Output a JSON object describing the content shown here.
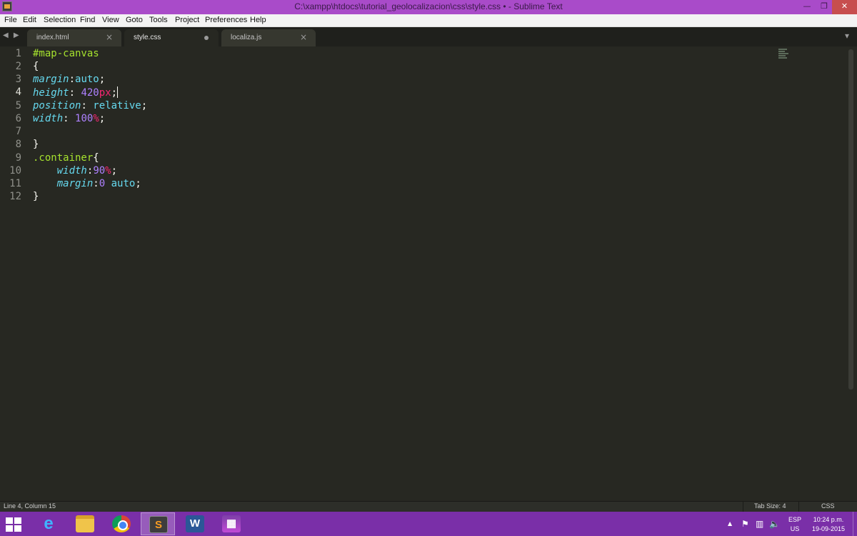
{
  "window": {
    "title": "C:\\xampp\\htdocs\\tutorial_geolocalizacion\\css\\style.css • - Sublime Text",
    "icons": {
      "app": "sublime-text-icon",
      "minimize": "minimize-icon",
      "maximize": "restore-icon",
      "close": "close-icon"
    },
    "minimize_glyph": "—",
    "maximize_glyph": "❐",
    "close_glyph": "✕"
  },
  "menu": [
    "File",
    "Edit",
    "Selection",
    "Find",
    "View",
    "Goto",
    "Tools",
    "Project",
    "Preferences",
    "Help"
  ],
  "tabs": [
    {
      "label": "index.html",
      "active": false,
      "dirty": false,
      "close_glyph": "×"
    },
    {
      "label": "style.css",
      "active": true,
      "dirty": true
    },
    {
      "label": "localiza.js",
      "active": false,
      "dirty": false,
      "close_glyph": "×"
    }
  ],
  "tabbar": {
    "nav_arrows": "◀ ▶",
    "overflow_glyph": "▾"
  },
  "editor": {
    "current_line": 4,
    "line_numbers": [
      "1",
      "2",
      "3",
      "4",
      "5",
      "6",
      "7",
      "8",
      "9",
      "10",
      "11",
      "12"
    ],
    "code": {
      "l1_selector": "#map-canvas",
      "l2_brace": "{",
      "l3_prop": "margin",
      "l3_colon": ":",
      "l3_val": "auto",
      "l3_semi": ";",
      "l4_prop": "height",
      "l4_colon": ": ",
      "l4_num": "420",
      "l4_unit": "px",
      "l4_semi": ";",
      "l5_prop": "position",
      "l5_colon": ": ",
      "l5_val": "relative",
      "l5_semi": ";",
      "l6_prop": "width",
      "l6_colon": ": ",
      "l6_num": "100",
      "l6_unit": "%",
      "l6_semi": ";",
      "l8_brace": "}",
      "l9_selector": ".container",
      "l9_brace": "{",
      "l10_indent": "    ",
      "l10_prop": "width",
      "l10_colon": ":",
      "l10_num": "90",
      "l10_unit": "%",
      "l10_semi": ";",
      "l11_indent": "    ",
      "l11_prop": "margin",
      "l11_colon": ":",
      "l11_num": "0",
      "l11_val": " auto",
      "l11_semi": ";",
      "l12_brace": "}"
    },
    "colors": {
      "background": "#272822",
      "selector": "#a6e22e",
      "property": "#66d9ef",
      "number": "#ae81ff",
      "unit": "#f92672",
      "text": "#f8f8f2"
    }
  },
  "status": {
    "position": "Line 4, Column 15",
    "tab_size": "Tab Size: 4",
    "syntax": "CSS"
  },
  "taskbar": {
    "apps": [
      {
        "name": "internet-explorer-icon",
        "glyph": "e",
        "active": false
      },
      {
        "name": "file-explorer-icon",
        "glyph": "",
        "active": false
      },
      {
        "name": "chrome-icon",
        "glyph": "",
        "active": false
      },
      {
        "name": "sublime-text-taskbar-icon",
        "glyph": "S",
        "active": true
      },
      {
        "name": "word-icon",
        "glyph": "W",
        "active": false
      },
      {
        "name": "winrar-icon",
        "glyph": "▦",
        "active": false
      }
    ],
    "tray_arrow": "▲",
    "tray_icons": [
      "flag-icon",
      "network-icon",
      "volume-icon"
    ],
    "tray_glyphs": [
      "⚑",
      "▥",
      "🔈"
    ],
    "lang_primary": "ESP",
    "lang_secondary": "US",
    "time": "10:24 p.m.",
    "date": "19-09-2015"
  }
}
